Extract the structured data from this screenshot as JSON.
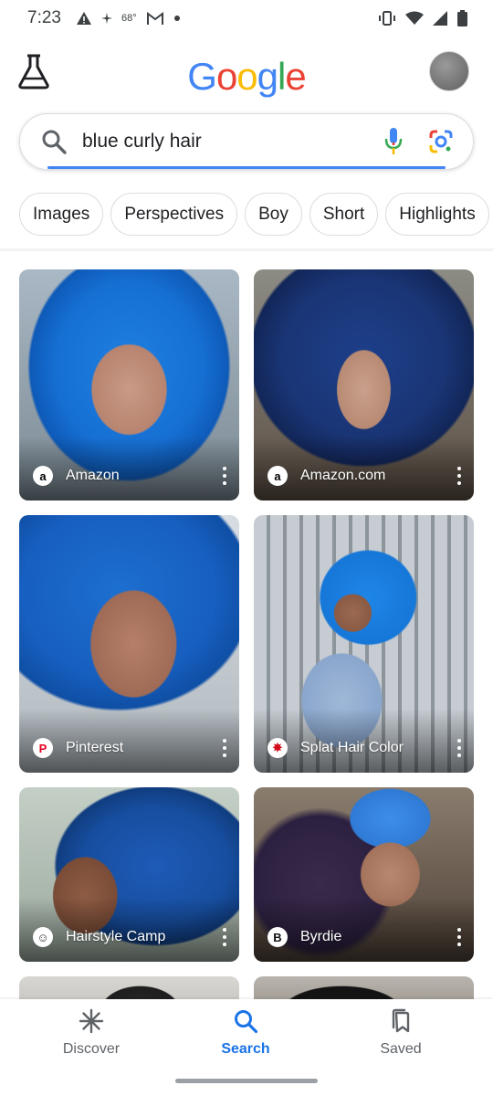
{
  "status_bar": {
    "time": "7:23",
    "temperature": "68°",
    "icons": [
      "alert-icon",
      "fan-icon",
      "gmail-icon",
      "dot-icon",
      "vibrate-icon",
      "wifi-icon",
      "signal-icon",
      "battery-icon"
    ]
  },
  "header": {
    "logo_letters": [
      "G",
      "o",
      "o",
      "g",
      "l",
      "e"
    ],
    "logo_colors": [
      "#4285F4",
      "#EA4335",
      "#FBBC05",
      "#4285F4",
      "#34A853",
      "#EA4335"
    ]
  },
  "search": {
    "query": "blue curly hair",
    "accent_color": "#4285F4"
  },
  "chips": [
    "Images",
    "Perspectives",
    "Boy",
    "Short",
    "Highlights"
  ],
  "results": [
    {
      "source": "Amazon",
      "favicon": "a",
      "favicon_color": "#000000"
    },
    {
      "source": "Amazon.com",
      "favicon": "a",
      "favicon_color": "#000000"
    },
    {
      "source": "Pinterest",
      "favicon": "P",
      "favicon_color": "#e60023"
    },
    {
      "source": "Splat Hair Color",
      "favicon": "✸",
      "favicon_color": "#d10f1e"
    },
    {
      "source": "Hairstyle Camp",
      "favicon": "☺",
      "favicon_color": "#333333"
    },
    {
      "source": "Byrdie",
      "favicon": "B",
      "favicon_color": "#111111"
    }
  ],
  "bottom_nav": {
    "items": [
      {
        "label": "Discover",
        "icon": "asterisk-icon",
        "active": false
      },
      {
        "label": "Search",
        "icon": "search-icon",
        "active": true
      },
      {
        "label": "Saved",
        "icon": "bookmarks-icon",
        "active": false
      }
    ],
    "active_color": "#1A73E8"
  }
}
